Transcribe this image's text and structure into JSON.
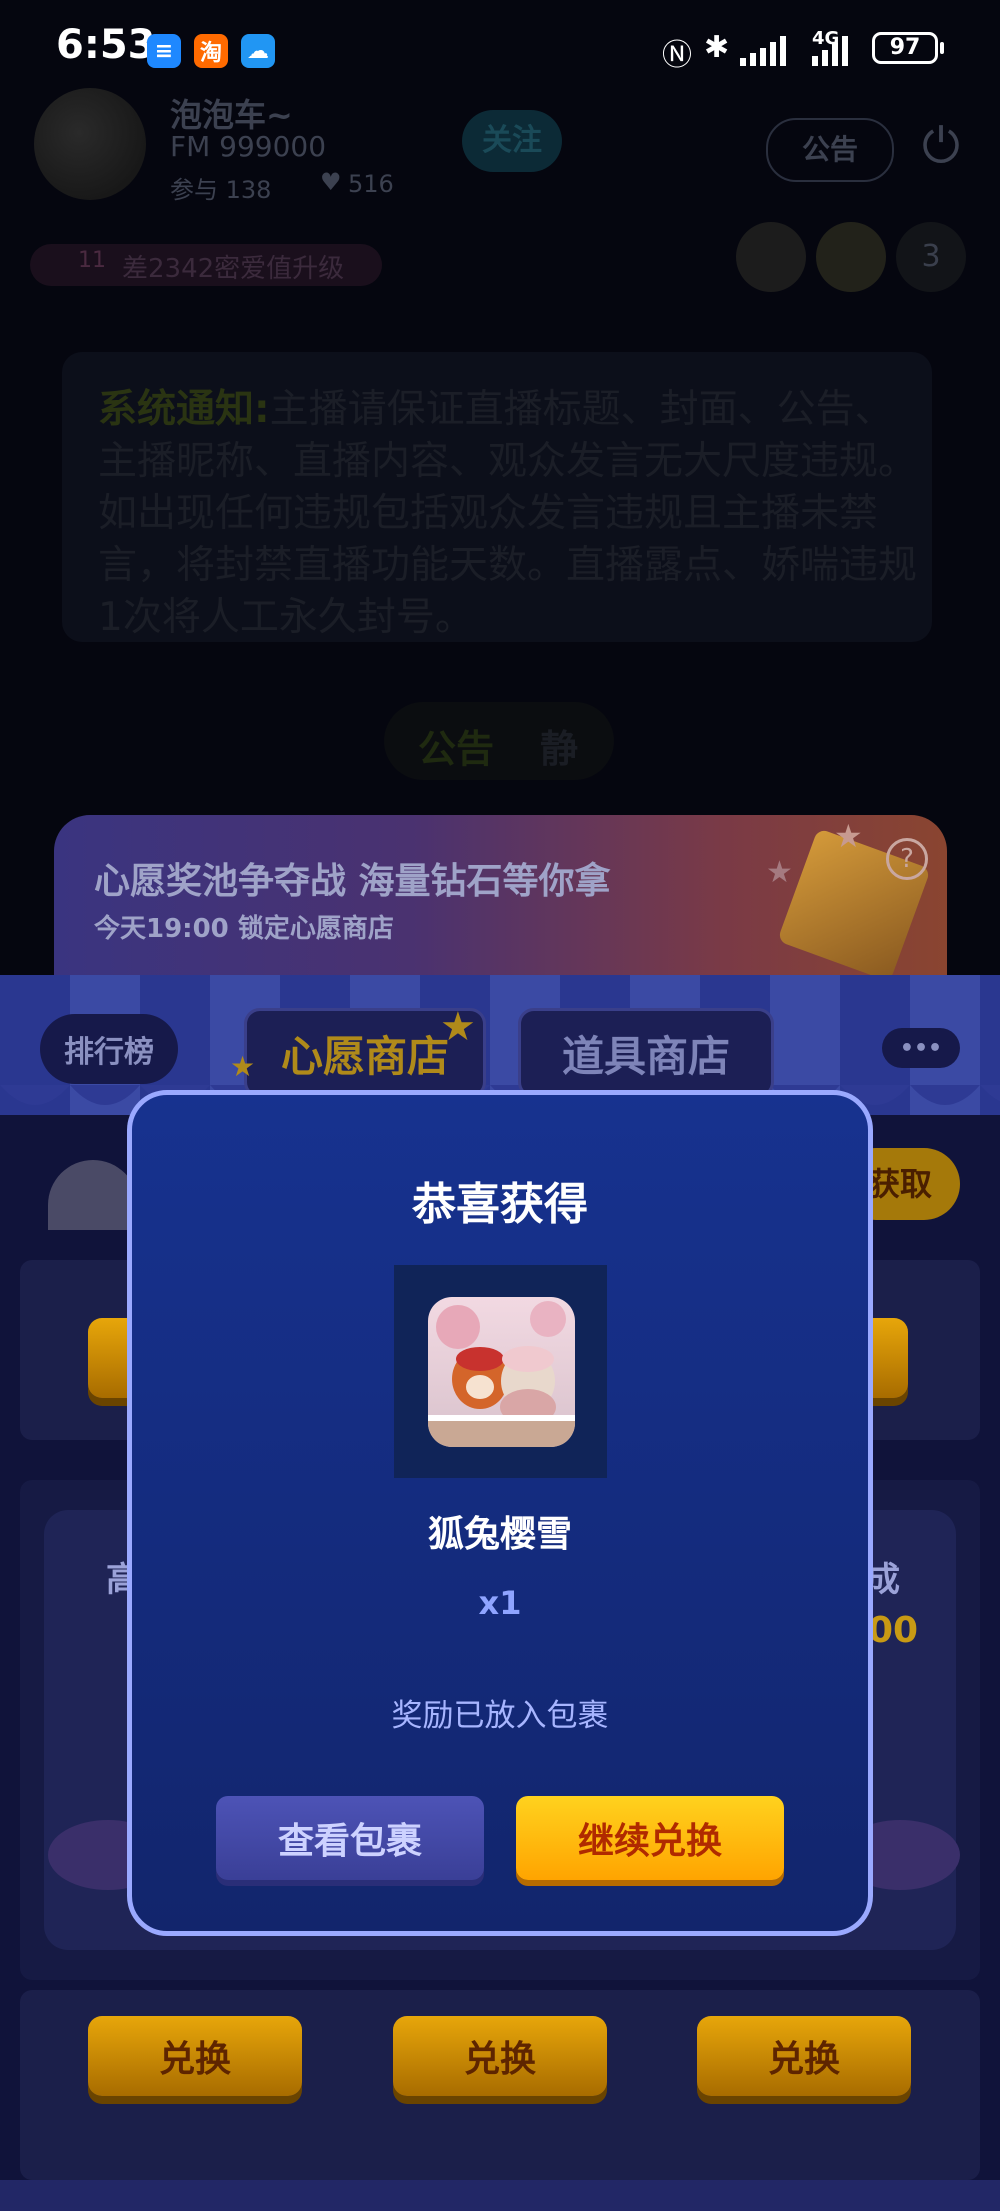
{
  "status_bar": {
    "time": "6:53",
    "apps": [
      {
        "icon": "alipay-icon",
        "glyph": "≡",
        "color": "#1e88ff"
      },
      {
        "icon": "taobao-icon",
        "glyph": "淘",
        "color": "#ff6a00"
      },
      {
        "icon": "weather-icon",
        "glyph": "☁",
        "color": "#2196f3"
      }
    ],
    "right_icons": [
      "nfc-icon",
      "bluetooth-icon",
      "signal-icon",
      "4g-signal-icon"
    ],
    "network_label": "4G",
    "battery": "97"
  },
  "room": {
    "name": "泡泡车~",
    "id": "FM 999000",
    "participants": "参与 138",
    "likes": "516",
    "follow_label": "关注",
    "announcement_label": "公告",
    "level_badge": "11",
    "level_text": "差2342密爱值升级",
    "audience_count": "3"
  },
  "notice": {
    "prefix": "系统通知:",
    "text": "主播请保证直播标题、封面、公告、主播昵称、直播内容、观众发言无大尺度违规。如出现任何违规包括观众发言违规且主播未禁言，将封禁直播功能天数。直播露点、娇喘违规1次将人工永久封号。"
  },
  "bottom_pill": {
    "left": "公告",
    "right": "静"
  },
  "banner": {
    "title": "心愿奖池争夺战 海量钻石等你拿",
    "subtitle": "今天19:00 锁定心愿商店",
    "help_glyph": "?"
  },
  "tabs": {
    "ranking": "排行榜",
    "wish_shop": "心愿商店",
    "prop_shop": "道具商店",
    "more_glyph": "•••"
  },
  "background_shop": {
    "get_label": "获取",
    "partial_left": "高",
    "partial_right": "成",
    "partial_price": "00",
    "exchange_buttons": [
      "兑换",
      "兑换",
      "兑换"
    ]
  },
  "modal": {
    "title": "恭喜获得",
    "item_name": "狐兔樱雪",
    "quantity": "x1",
    "message": "奖励已放入包裹",
    "view_button": "查看包裹",
    "continue_button": "继续兑换"
  }
}
